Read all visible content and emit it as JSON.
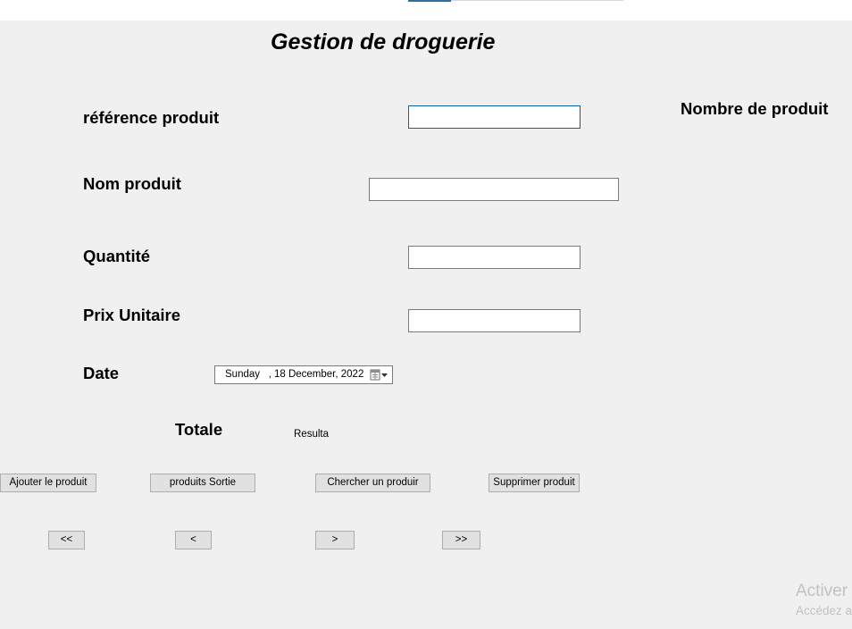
{
  "form": {
    "title": "Gestion de droguerie",
    "labels": {
      "reference": "référence produit",
      "nom": "Nom produit",
      "quantite": "Quantité",
      "prix": "Prix Unitaire",
      "date": "Date",
      "totale": "Totale",
      "nombre": "Nombre de produit"
    },
    "fields": {
      "reference": "",
      "nom": "",
      "quantite": "",
      "prix": ""
    },
    "date_value": "Sunday   , 18 December, 2022",
    "result_text": "Resulta"
  },
  "buttons": {
    "add": "Ajouter le produit",
    "out": "produits Sortie",
    "search": "Chercher un produir",
    "delete": "Supprimer produit",
    "first": "<<",
    "prev": "<",
    "next": ">",
    "last": ">>"
  },
  "watermark": {
    "line1": "Activer",
    "line2": "Accédez a"
  }
}
